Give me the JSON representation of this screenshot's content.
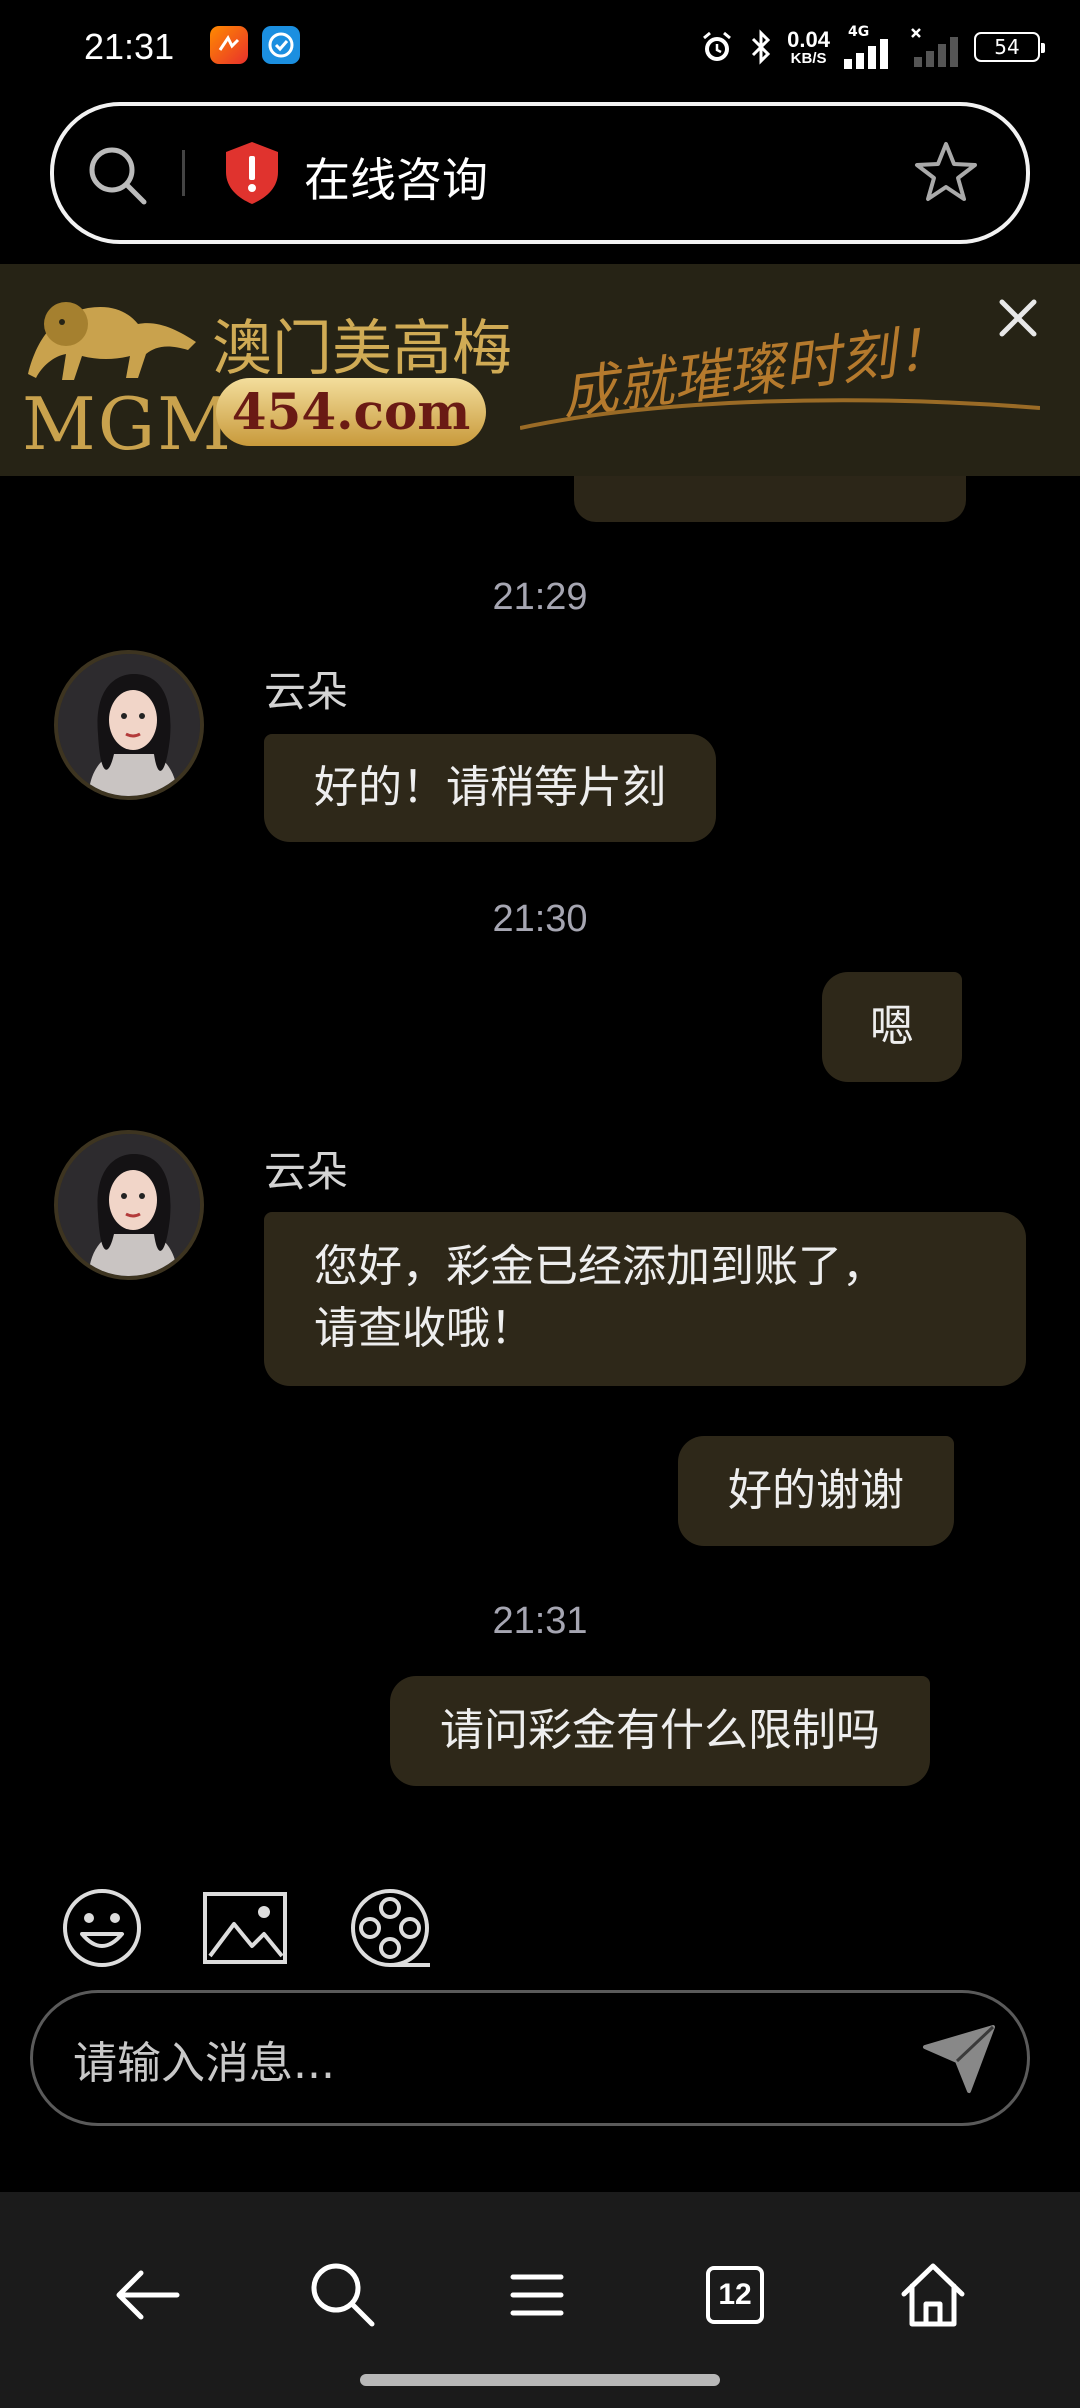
{
  "status_bar": {
    "time": "21:31",
    "net_speed": "0.04",
    "net_unit": "KB/S",
    "network_type": "4G",
    "battery": "54",
    "icons": [
      "notification-app-icon",
      "message-app-icon",
      "alarm-icon",
      "bluetooth-icon",
      "signal-icon",
      "no-signal-icon",
      "battery-icon"
    ]
  },
  "address_bar": {
    "title": "在线咨询",
    "icons": [
      "search-icon",
      "security-shield-icon",
      "bookmark-star-icon"
    ]
  },
  "ad_banner": {
    "brand_latin": "MGM",
    "brand_cn": "澳门美高梅",
    "domain": "454.com",
    "slogan": "成就璀璨时刻！",
    "accent": "#c9a24d"
  },
  "chat": {
    "messages": [
      {
        "time": "21:29"
      },
      {
        "sender": "云朵",
        "text": "好的！请稍等片刻",
        "direction": "in"
      },
      {
        "time": "21:30"
      },
      {
        "text": "嗯",
        "direction": "out"
      },
      {
        "sender": "云朵",
        "lines": [
          "您好，彩金已经添加到账了，",
          "请查收哦！"
        ],
        "direction": "in"
      },
      {
        "text": "好的谢谢",
        "direction": "out"
      },
      {
        "time": "21:31"
      },
      {
        "text": "请问彩金有什么限制吗",
        "direction": "out"
      }
    ],
    "bubble_color": "#2e2819"
  },
  "toolbar": {
    "icons": [
      "emoji-icon",
      "image-icon",
      "video-reel-icon"
    ]
  },
  "composer": {
    "placeholder": "请输入消息...",
    "send_icon": "send-icon"
  },
  "bottom_nav": {
    "items": [
      "back-icon",
      "search-icon",
      "menu-icon",
      "tabs-icon",
      "home-icon"
    ],
    "tab_count": "12"
  }
}
